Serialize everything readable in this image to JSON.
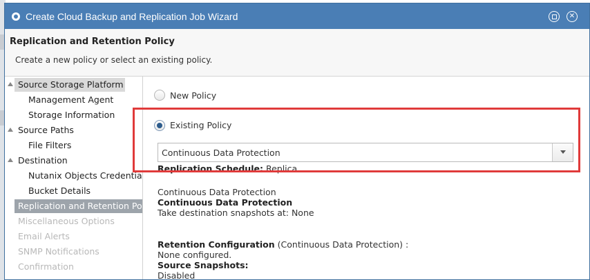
{
  "window": {
    "title": "Create Cloud Backup and Replication Job Wizard"
  },
  "header": {
    "title": "Replication and Retention Policy",
    "subtitle": "Create a new policy or select an existing policy."
  },
  "nav": {
    "items": [
      {
        "label": "Source Storage Platform",
        "state": "selected"
      },
      {
        "label": "Management Agent",
        "state": "normal"
      },
      {
        "label": "Storage Information",
        "state": "normal"
      },
      {
        "label": "Source Paths",
        "state": "normal"
      },
      {
        "label": "File Filters",
        "state": "normal"
      },
      {
        "label": "Destination",
        "state": "normal"
      },
      {
        "label": "Nutanix Objects Credentials",
        "state": "normal"
      },
      {
        "label": "Bucket Details",
        "state": "normal"
      },
      {
        "label": "Replication and Retention Policy",
        "state": "current"
      },
      {
        "label": "Miscellaneous Options",
        "state": "disabled"
      },
      {
        "label": "Email Alerts",
        "state": "disabled"
      },
      {
        "label": "SNMP Notifications",
        "state": "disabled"
      },
      {
        "label": "Confirmation",
        "state": "disabled"
      }
    ]
  },
  "policy": {
    "new_label": "New Policy",
    "existing_label": "Existing Policy",
    "selected": "existing",
    "dropdown_value": "Continuous Data Protection"
  },
  "details": {
    "schedule_label": "Replication Schedule:",
    "schedule_value": "Replica",
    "policy_name": "Continuous Data Protection",
    "policy_name_bold": "Continuous Data Protection",
    "snapshots_line": "Take destination snapshots at: None",
    "retention_label": "Retention Configuration",
    "retention_value": "(Continuous Data Protection) :",
    "retention_none": "None configured.",
    "source_snapshots_label": "Source Snapshots:",
    "source_snapshots_value": "Disabled"
  },
  "colors": {
    "titlebar": "#4a7eb5",
    "highlight": "#e03a3a",
    "nav_current": "#9da4ab",
    "radio_checked": "#2d5c8c"
  }
}
